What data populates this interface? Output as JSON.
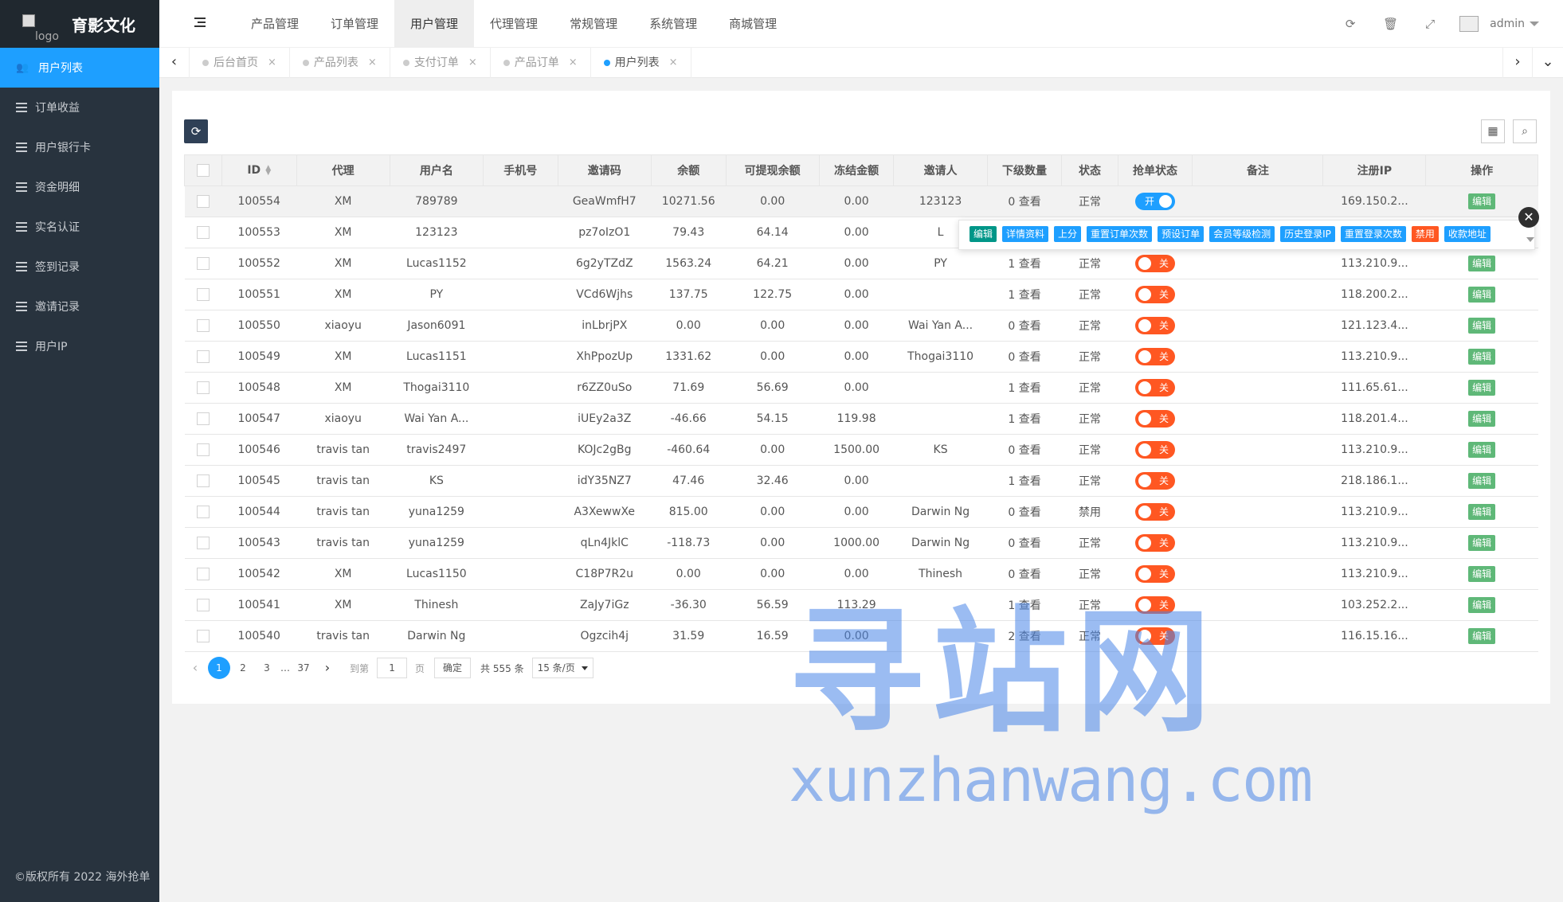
{
  "app": {
    "logo_alt": "logo",
    "title": "育影文化",
    "copyright": "©版权所有 2022 海外抢单"
  },
  "sidebar": {
    "items": [
      {
        "label": "用户列表",
        "icon": "users-icon",
        "active": true
      },
      {
        "label": "订单收益",
        "icon": "list-icon",
        "active": false
      },
      {
        "label": "用户银行卡",
        "icon": "list-icon",
        "active": false
      },
      {
        "label": "资金明细",
        "icon": "list-icon",
        "active": false
      },
      {
        "label": "实名认证",
        "icon": "list-icon",
        "active": false
      },
      {
        "label": "签到记录",
        "icon": "list-icon",
        "active": false
      },
      {
        "label": "邀请记录",
        "icon": "list-icon",
        "active": false
      },
      {
        "label": "用户IP",
        "icon": "list-icon",
        "active": false
      }
    ]
  },
  "header": {
    "nav": [
      {
        "label": "产品管理",
        "active": false
      },
      {
        "label": "订单管理",
        "active": false
      },
      {
        "label": "用户管理",
        "active": true
      },
      {
        "label": "代理管理",
        "active": false
      },
      {
        "label": "常规管理",
        "active": false
      },
      {
        "label": "系统管理",
        "active": false
      },
      {
        "label": "商城管理",
        "active": false
      }
    ],
    "user": "admin"
  },
  "tabs": [
    {
      "label": "后台首页",
      "active": false
    },
    {
      "label": "产品列表",
      "active": false
    },
    {
      "label": "支付订单",
      "active": false
    },
    {
      "label": "产品订单",
      "active": false
    },
    {
      "label": "用户列表",
      "active": true
    }
  ],
  "table": {
    "columns": [
      "ID",
      "代理",
      "用户名",
      "手机号",
      "邀请码",
      "余额",
      "可提现余额",
      "冻结金额",
      "邀请人",
      "下级数量",
      "状态",
      "抢单状态",
      "备注",
      "注册IP",
      "操作"
    ],
    "rows": [
      {
        "id": "100554",
        "agent": "XM",
        "username": "789789",
        "phone": "",
        "code": "GeaWmfH7",
        "balance": "10271.56",
        "withdrawable": "0.00",
        "frozen": "0.00",
        "inviter": "123123",
        "subs": "0 查看",
        "status": "正常",
        "grab": "开",
        "grab_on": true,
        "note": "",
        "ip": "169.150.2...",
        "op": "编辑"
      },
      {
        "id": "100553",
        "agent": "XM",
        "username": "123123",
        "phone": "",
        "code": "pz7oIzO1",
        "balance": "79.43",
        "withdrawable": "64.14",
        "frozen": "0.00",
        "inviter": "L",
        "subs": "",
        "status": "",
        "grab": "",
        "grab_on": null,
        "note": "",
        "ip": "",
        "op": ""
      },
      {
        "id": "100552",
        "agent": "XM",
        "username": "Lucas1152",
        "phone": "",
        "code": "6g2yTZdZ",
        "balance": "1563.24",
        "withdrawable": "64.21",
        "frozen": "0.00",
        "inviter": "PY",
        "subs": "1 查看",
        "status": "正常",
        "grab": "关",
        "grab_on": false,
        "note": "",
        "ip": "113.210.9...",
        "op": "编辑"
      },
      {
        "id": "100551",
        "agent": "XM",
        "username": "PY",
        "phone": "",
        "code": "VCd6Wjhs",
        "balance": "137.75",
        "withdrawable": "122.75",
        "frozen": "0.00",
        "inviter": "",
        "subs": "1 查看",
        "status": "正常",
        "grab": "关",
        "grab_on": false,
        "note": "",
        "ip": "118.200.2...",
        "op": "编辑"
      },
      {
        "id": "100550",
        "agent": "xiaoyu",
        "username": "Jason6091",
        "phone": "",
        "code": "inLbrjPX",
        "balance": "0.00",
        "withdrawable": "0.00",
        "frozen": "0.00",
        "inviter": "Wai Yan A...",
        "subs": "0 查看",
        "status": "正常",
        "grab": "关",
        "grab_on": false,
        "note": "",
        "ip": "121.123.4...",
        "op": "编辑"
      },
      {
        "id": "100549",
        "agent": "XM",
        "username": "Lucas1151",
        "phone": "",
        "code": "XhPpozUp",
        "balance": "1331.62",
        "withdrawable": "0.00",
        "frozen": "0.00",
        "inviter": "Thogai3110",
        "subs": "0 查看",
        "status": "正常",
        "grab": "关",
        "grab_on": false,
        "note": "",
        "ip": "113.210.9...",
        "op": "编辑"
      },
      {
        "id": "100548",
        "agent": "XM",
        "username": "Thogai3110",
        "phone": "",
        "code": "r6ZZ0uSo",
        "balance": "71.69",
        "withdrawable": "56.69",
        "frozen": "0.00",
        "inviter": "",
        "subs": "1 查看",
        "status": "正常",
        "grab": "关",
        "grab_on": false,
        "note": "",
        "ip": "111.65.61...",
        "op": "编辑"
      },
      {
        "id": "100547",
        "agent": "xiaoyu",
        "username": "Wai Yan A...",
        "phone": "",
        "code": "iUEy2a3Z",
        "balance": "-46.66",
        "withdrawable": "54.15",
        "frozen": "119.98",
        "inviter": "",
        "subs": "1 查看",
        "status": "正常",
        "grab": "关",
        "grab_on": false,
        "note": "",
        "ip": "118.201.4...",
        "op": "编辑"
      },
      {
        "id": "100546",
        "agent": "travis tan",
        "username": "travis2497",
        "phone": "",
        "code": "KOJc2gBg",
        "balance": "-460.64",
        "withdrawable": "0.00",
        "frozen": "1500.00",
        "inviter": "KS",
        "subs": "0 查看",
        "status": "正常",
        "grab": "关",
        "grab_on": false,
        "note": "",
        "ip": "113.210.9...",
        "op": "编辑"
      },
      {
        "id": "100545",
        "agent": "travis tan",
        "username": "KS",
        "phone": "",
        "code": "idY35NZ7",
        "balance": "47.46",
        "withdrawable": "32.46",
        "frozen": "0.00",
        "inviter": "",
        "subs": "1 查看",
        "status": "正常",
        "grab": "关",
        "grab_on": false,
        "note": "",
        "ip": "218.186.1...",
        "op": "编辑"
      },
      {
        "id": "100544",
        "agent": "travis tan",
        "username": "yuna1259",
        "phone": "",
        "code": "A3XewwXe",
        "balance": "815.00",
        "withdrawable": "0.00",
        "frozen": "0.00",
        "inviter": "Darwin Ng",
        "subs": "0 查看",
        "status": "禁用",
        "grab": "关",
        "grab_on": false,
        "note": "",
        "ip": "113.210.9...",
        "op": "编辑"
      },
      {
        "id": "100543",
        "agent": "travis tan",
        "username": "yuna1259",
        "phone": "",
        "code": "qLn4JklC",
        "balance": "-118.73",
        "withdrawable": "0.00",
        "frozen": "1000.00",
        "inviter": "Darwin Ng",
        "subs": "0 查看",
        "status": "正常",
        "grab": "关",
        "grab_on": false,
        "note": "",
        "ip": "113.210.9...",
        "op": "编辑"
      },
      {
        "id": "100542",
        "agent": "XM",
        "username": "Lucas1150",
        "phone": "",
        "code": "C18P7R2u",
        "balance": "0.00",
        "withdrawable": "0.00",
        "frozen": "0.00",
        "inviter": "Thinesh",
        "subs": "0 查看",
        "status": "正常",
        "grab": "关",
        "grab_on": false,
        "note": "",
        "ip": "113.210.9...",
        "op": "编辑"
      },
      {
        "id": "100541",
        "agent": "XM",
        "username": "Thinesh",
        "phone": "",
        "code": "ZaJy7iGz",
        "balance": "-36.30",
        "withdrawable": "56.59",
        "frozen": "113.29",
        "inviter": "",
        "subs": "1 查看",
        "status": "正常",
        "grab": "关",
        "grab_on": false,
        "note": "",
        "ip": "103.252.2...",
        "op": "编辑"
      },
      {
        "id": "100540",
        "agent": "travis tan",
        "username": "Darwin Ng",
        "phone": "",
        "code": "Ogzcih4j",
        "balance": "31.59",
        "withdrawable": "16.59",
        "frozen": "0.00",
        "inviter": "",
        "subs": "2 查看",
        "status": "正常",
        "grab": "关",
        "grab_on": false,
        "note": "",
        "ip": "116.15.16...",
        "op": "编辑"
      }
    ]
  },
  "ops_popup": {
    "buttons": [
      {
        "label": "编辑",
        "color": "green"
      },
      {
        "label": "详情资料",
        "color": "blue"
      },
      {
        "label": "上分",
        "color": "blue"
      },
      {
        "label": "重置订单次数",
        "color": "blue"
      },
      {
        "label": "预设订单",
        "color": "blue"
      },
      {
        "label": "会员等级检测",
        "color": "blue"
      },
      {
        "label": "历史登录IP",
        "color": "blue"
      },
      {
        "label": "重置登录次数",
        "color": "blue"
      },
      {
        "label": "禁用",
        "color": "orange"
      },
      {
        "label": "收款地址",
        "color": "blue"
      }
    ]
  },
  "pager": {
    "pages": [
      "1",
      "2",
      "3",
      "…",
      "37"
    ],
    "current": "1",
    "goto_label": "到第",
    "goto_value": "1",
    "page_unit": "页",
    "confirm": "确定",
    "total": "共 555 条",
    "page_size": "15 条/页"
  },
  "watermark": {
    "big": "寻站网",
    "small": "xunzhanwang.com"
  },
  "colors": {
    "sidebar_bg": "#28333e",
    "accent": "#1e9fff",
    "edit_green": "#5fb878",
    "switch_off": "#ff5722"
  }
}
